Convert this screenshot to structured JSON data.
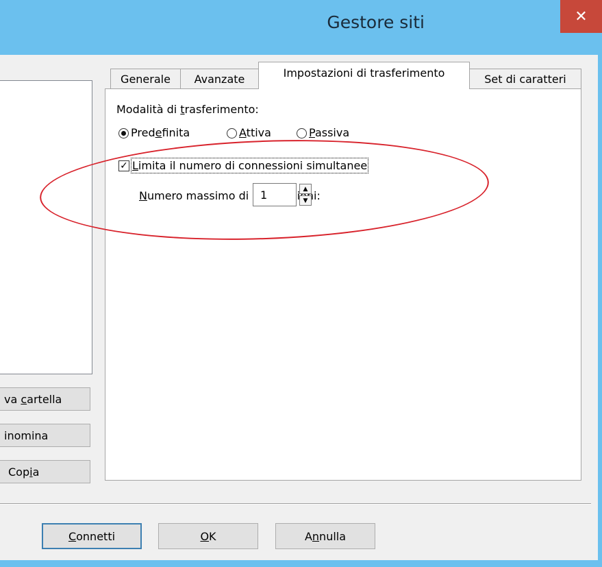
{
  "window": {
    "title": "Gestore siti",
    "close_glyph": "✕"
  },
  "tabs": [
    {
      "label": "Generale"
    },
    {
      "label": "Avanzate"
    },
    {
      "label": "Impostazioni di trasferimento"
    },
    {
      "label": "Set di caratteri"
    }
  ],
  "transfer": {
    "mode_label": "Modalità di trasferimento:",
    "modes": [
      {
        "label": "Predefinita",
        "checked": true
      },
      {
        "label": "Attiva",
        "checked": false
      },
      {
        "label": "Passiva",
        "checked": false
      }
    ],
    "limit_label": "Limita il numero di connessioni simultanee",
    "limit_checked": true,
    "max_label": "Numero massimo di connessioni:",
    "max_value": "1"
  },
  "side_buttons": [
    {
      "label": "va cartella"
    },
    {
      "label": "inomina"
    },
    {
      "label": "Copia"
    }
  ],
  "footer": {
    "connect": "Connetti",
    "ok": "OK",
    "cancel": "Annulla"
  },
  "colors": {
    "titlebar": "#6bc0ee",
    "close": "#c7483a",
    "annotation": "#d8222b",
    "default_button_border": "#3c7fb1"
  }
}
